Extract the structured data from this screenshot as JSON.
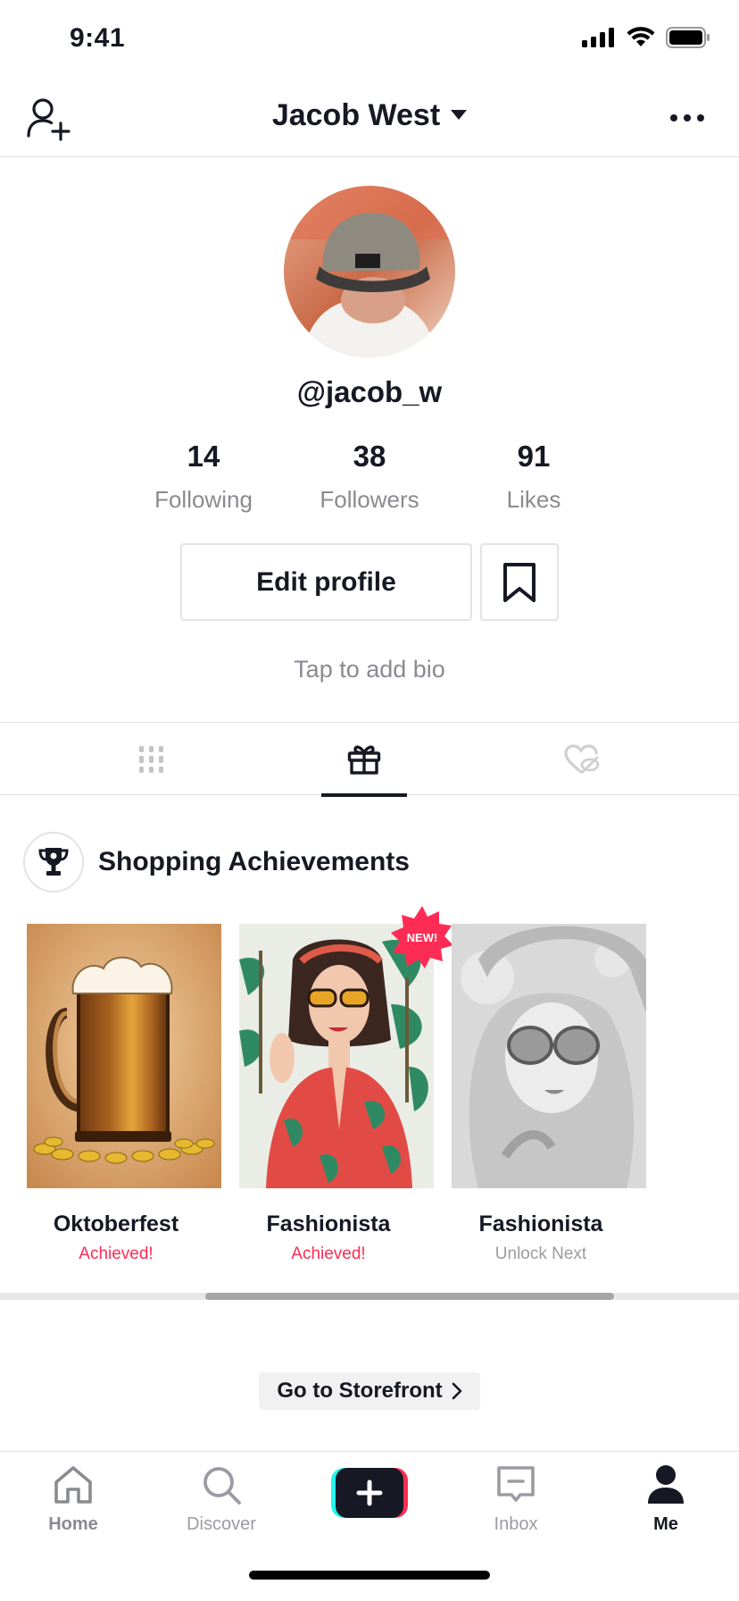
{
  "status_bar": {
    "time": "9:41"
  },
  "header": {
    "title": "Jacob West"
  },
  "profile": {
    "username": "@jacob_w",
    "stats": [
      {
        "value": "14",
        "label": "Following"
      },
      {
        "value": "38",
        "label": "Followers"
      },
      {
        "value": "91",
        "label": "Likes"
      }
    ],
    "edit_label": "Edit profile",
    "bio_placeholder": "Tap to add bio"
  },
  "achievements": {
    "title": "Shopping Achievements",
    "cards": [
      {
        "name": "Oktoberfest",
        "status": "Achieved!",
        "locked": false
      },
      {
        "name": "Fashionista",
        "status": "Achieved!",
        "locked": false,
        "badge": "NEW!"
      },
      {
        "name": "Fashionista",
        "status": "Unlock Next",
        "locked": true
      }
    ],
    "storefront_label": "Go to Storefront"
  },
  "nav": {
    "items": [
      {
        "label": "Home",
        "icon": "home-icon"
      },
      {
        "label": "Discover",
        "icon": "search-icon"
      },
      {
        "label": "",
        "icon": "plus-icon"
      },
      {
        "label": "Inbox",
        "icon": "inbox-icon"
      },
      {
        "label": "Me",
        "icon": "person-icon"
      }
    ]
  },
  "colors": {
    "accent": "#fe2c55",
    "text": "#161823",
    "muted": "#8a8b91",
    "cyan": "#25f4ee"
  }
}
